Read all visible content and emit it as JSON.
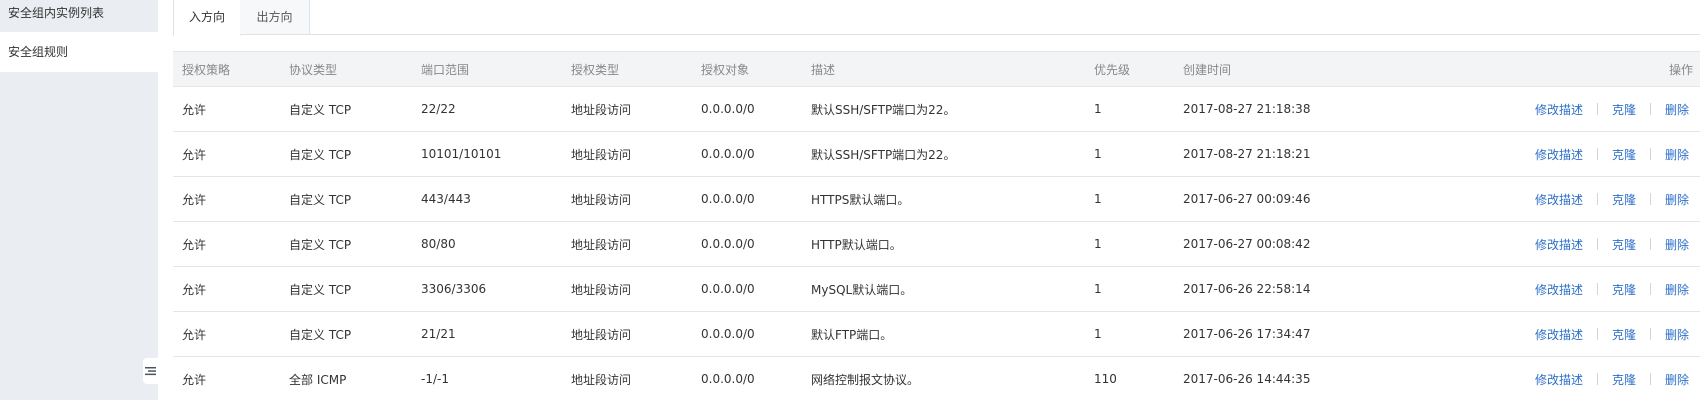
{
  "sidebar": {
    "items": [
      {
        "label": "安全组内实例列表"
      },
      {
        "label": "安全组规则"
      }
    ]
  },
  "collapse_icon": "menu-collapse-icon",
  "tabs": [
    {
      "label": "入方向",
      "active": true
    },
    {
      "label": "出方向",
      "active": false
    }
  ],
  "table": {
    "headers": [
      "授权策略",
      "协议类型",
      "端口范围",
      "授权类型",
      "授权对象",
      "描述",
      "优先级",
      "创建时间",
      "操作"
    ],
    "actions": {
      "edit": "修改描述",
      "clone": "克隆",
      "delete": "删除"
    },
    "rows": [
      {
        "policy": "允许",
        "protocol": "自定义 TCP",
        "port": "22/22",
        "auth_type": "地址段访问",
        "auth_obj": "0.0.0.0/0",
        "desc": "默认SSH/SFTP端口为22。",
        "priority": "1",
        "created": "2017-08-27 21:18:38"
      },
      {
        "policy": "允许",
        "protocol": "自定义 TCP",
        "port": "10101/10101",
        "auth_type": "地址段访问",
        "auth_obj": "0.0.0.0/0",
        "desc": "默认SSH/SFTP端口为22。",
        "priority": "1",
        "created": "2017-08-27 21:18:21"
      },
      {
        "policy": "允许",
        "protocol": "自定义 TCP",
        "port": "443/443",
        "auth_type": "地址段访问",
        "auth_obj": "0.0.0.0/0",
        "desc": "HTTPS默认端口。",
        "priority": "1",
        "created": "2017-06-27 00:09:46"
      },
      {
        "policy": "允许",
        "protocol": "自定义 TCP",
        "port": "80/80",
        "auth_type": "地址段访问",
        "auth_obj": "0.0.0.0/0",
        "desc": "HTTP默认端口。",
        "priority": "1",
        "created": "2017-06-27 00:08:42"
      },
      {
        "policy": "允许",
        "protocol": "自定义 TCP",
        "port": "3306/3306",
        "auth_type": "地址段访问",
        "auth_obj": "0.0.0.0/0",
        "desc": "MySQL默认端口。",
        "priority": "1",
        "created": "2017-06-26 22:58:14"
      },
      {
        "policy": "允许",
        "protocol": "自定义 TCP",
        "port": "21/21",
        "auth_type": "地址段访问",
        "auth_obj": "0.0.0.0/0",
        "desc": "默认FTP端口。",
        "priority": "1",
        "created": "2017-06-26 17:34:47"
      },
      {
        "policy": "允许",
        "protocol": "全部 ICMP",
        "port": "-1/-1",
        "auth_type": "地址段访问",
        "auth_obj": "0.0.0.0/0",
        "desc": "网络控制报文协议。",
        "priority": "110",
        "created": "2017-06-26 14:44:35"
      }
    ]
  },
  "colors": {
    "link": "#2c6fc9",
    "sidebar_bg": "#eaedf1",
    "header_bg": "#f2f4f6"
  }
}
